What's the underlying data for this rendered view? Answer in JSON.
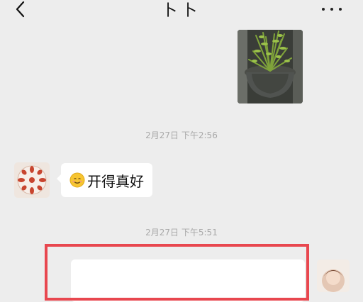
{
  "header": {
    "title": "卜卜"
  },
  "messages": {
    "timestamp_1": "2月27日 下午2:56",
    "incoming_text": "开得真好",
    "timestamp_2": "2月27日 下午5:51"
  },
  "colors": {
    "background": "#ededed",
    "bubble": "#ffffff",
    "highlight_border": "#e8474f"
  }
}
